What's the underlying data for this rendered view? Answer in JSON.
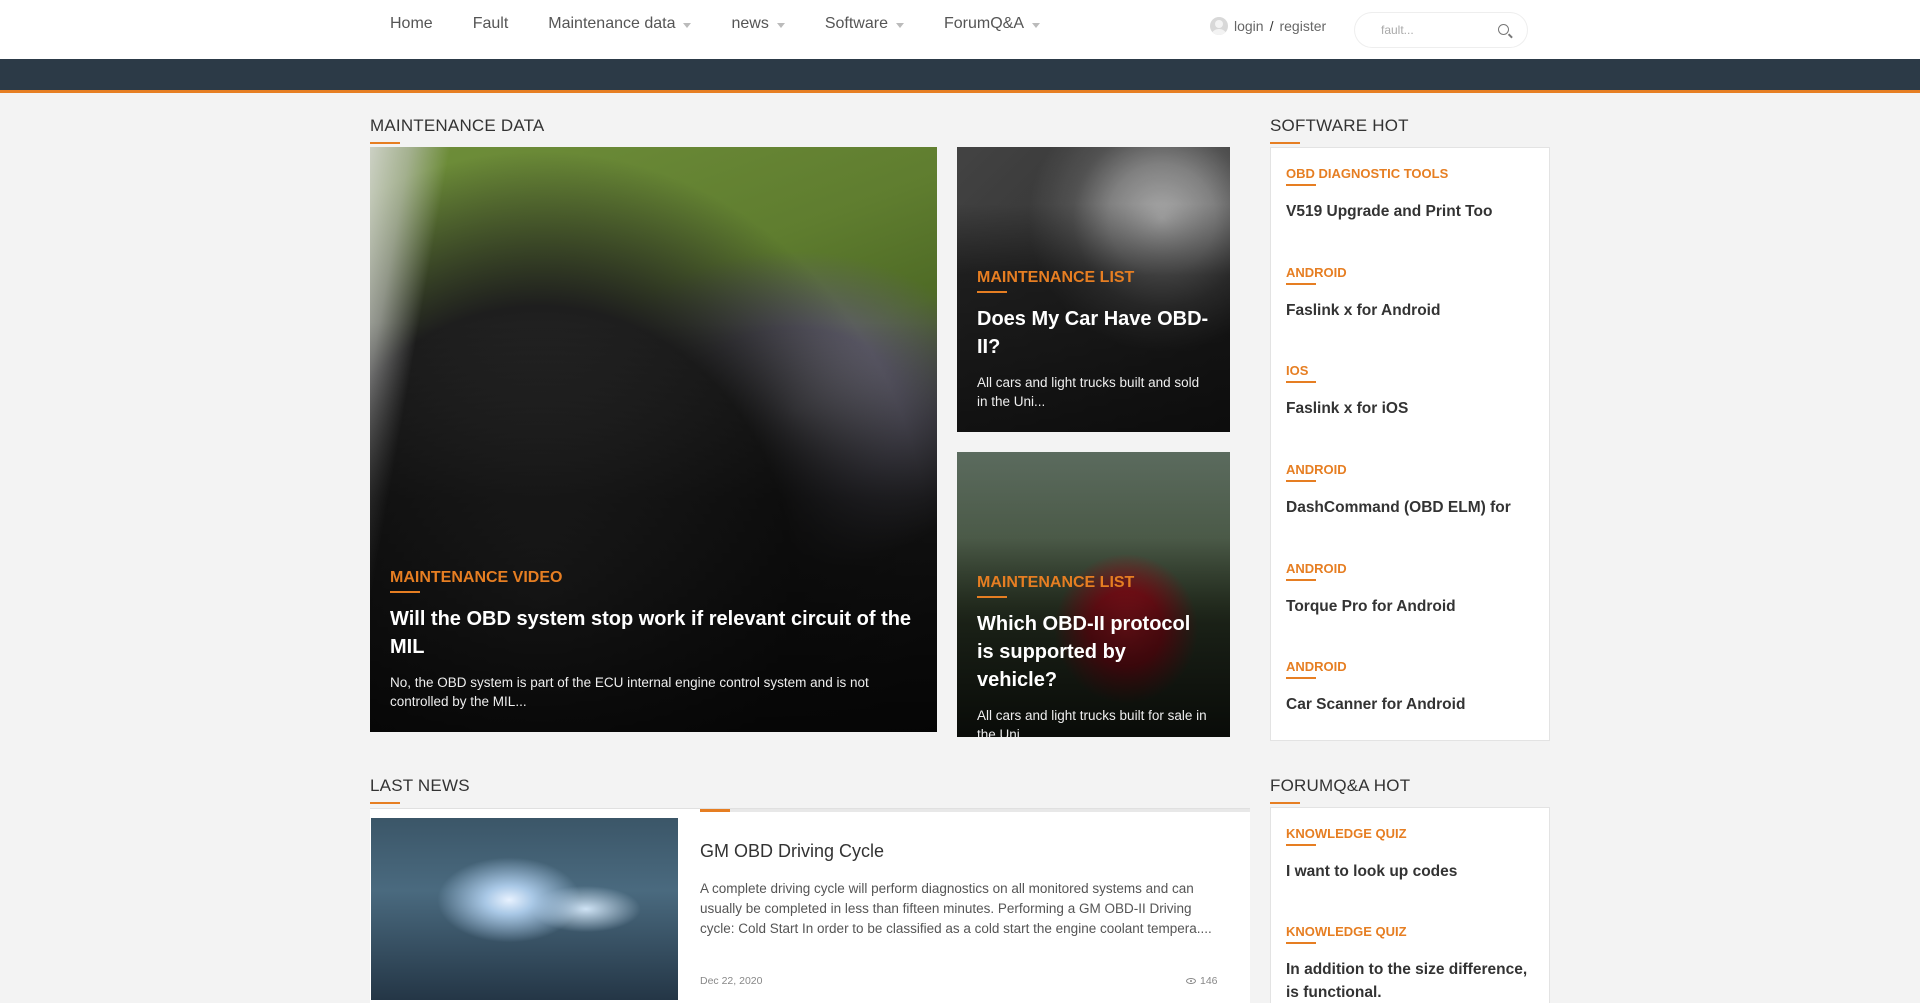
{
  "nav": {
    "items": [
      {
        "label": "Home",
        "dropdown": false
      },
      {
        "label": "Fault",
        "dropdown": false
      },
      {
        "label": "Maintenance data",
        "dropdown": true
      },
      {
        "label": "news",
        "dropdown": true
      },
      {
        "label": "Software",
        "dropdown": true
      },
      {
        "label": "ForumQ&A",
        "dropdown": true
      }
    ],
    "login": "login",
    "separator": "/",
    "register": "register",
    "search_placeholder": "fault..."
  },
  "maintenance": {
    "section_title": "MAINTENANCE DATA",
    "featured": {
      "category": "MAINTENANCE VIDEO",
      "title": "Will the OBD system stop work if relevant circuit of the MIL",
      "excerpt": "No, the OBD system is part of the ECU internal engine control system and is not controlled by the MIL..."
    },
    "side1": {
      "category": "MAINTENANCE LIST",
      "title": "Does My Car Have OBD-II?",
      "excerpt": "All cars and light trucks built and sold in the Uni..."
    },
    "side2": {
      "category": "MAINTENANCE LIST",
      "title": "Which OBD-II protocol is supported by vehicle?",
      "excerpt": "All cars and light trucks built for sale in the Uni..."
    }
  },
  "software_hot": {
    "section_title": "SOFTWARE HOT",
    "items": [
      {
        "category": "OBD DIAGNOSTIC TOOLS",
        "title": "V519 Upgrade and Print Too"
      },
      {
        "category": "ANDROID",
        "title": "Faslink x for Android"
      },
      {
        "category": "IOS",
        "title": "Faslink x for iOS"
      },
      {
        "category": "ANDROID",
        "title": "DashCommand (OBD ELM) for"
      },
      {
        "category": "ANDROID",
        "title": "Torque Pro for Android"
      },
      {
        "category": "ANDROID",
        "title": "Car Scanner for Android"
      }
    ]
  },
  "last_news": {
    "section_title": "LAST NEWS",
    "item": {
      "title": "GM OBD Driving Cycle",
      "excerpt": "A complete driving cycle will perform diagnostics on all monitored systems and can usually be completed in less than fifteen minutes. Performing a GM OBD-II Driving cycle: Cold Start In order to be classified as a cold start the engine coolant tempera....",
      "date": "Dec 22, 2020",
      "views": "146"
    }
  },
  "forum_hot": {
    "section_title": "FORUMQ&A HOT",
    "items": [
      {
        "category": "KNOWLEDGE QUIZ",
        "title": "I want to look up codes"
      },
      {
        "category": "KNOWLEDGE QUIZ",
        "title": "In addition to the size difference, is functional."
      }
    ]
  },
  "colors": {
    "accent": "#e67e22",
    "dark_bar": "#2c3a47"
  }
}
